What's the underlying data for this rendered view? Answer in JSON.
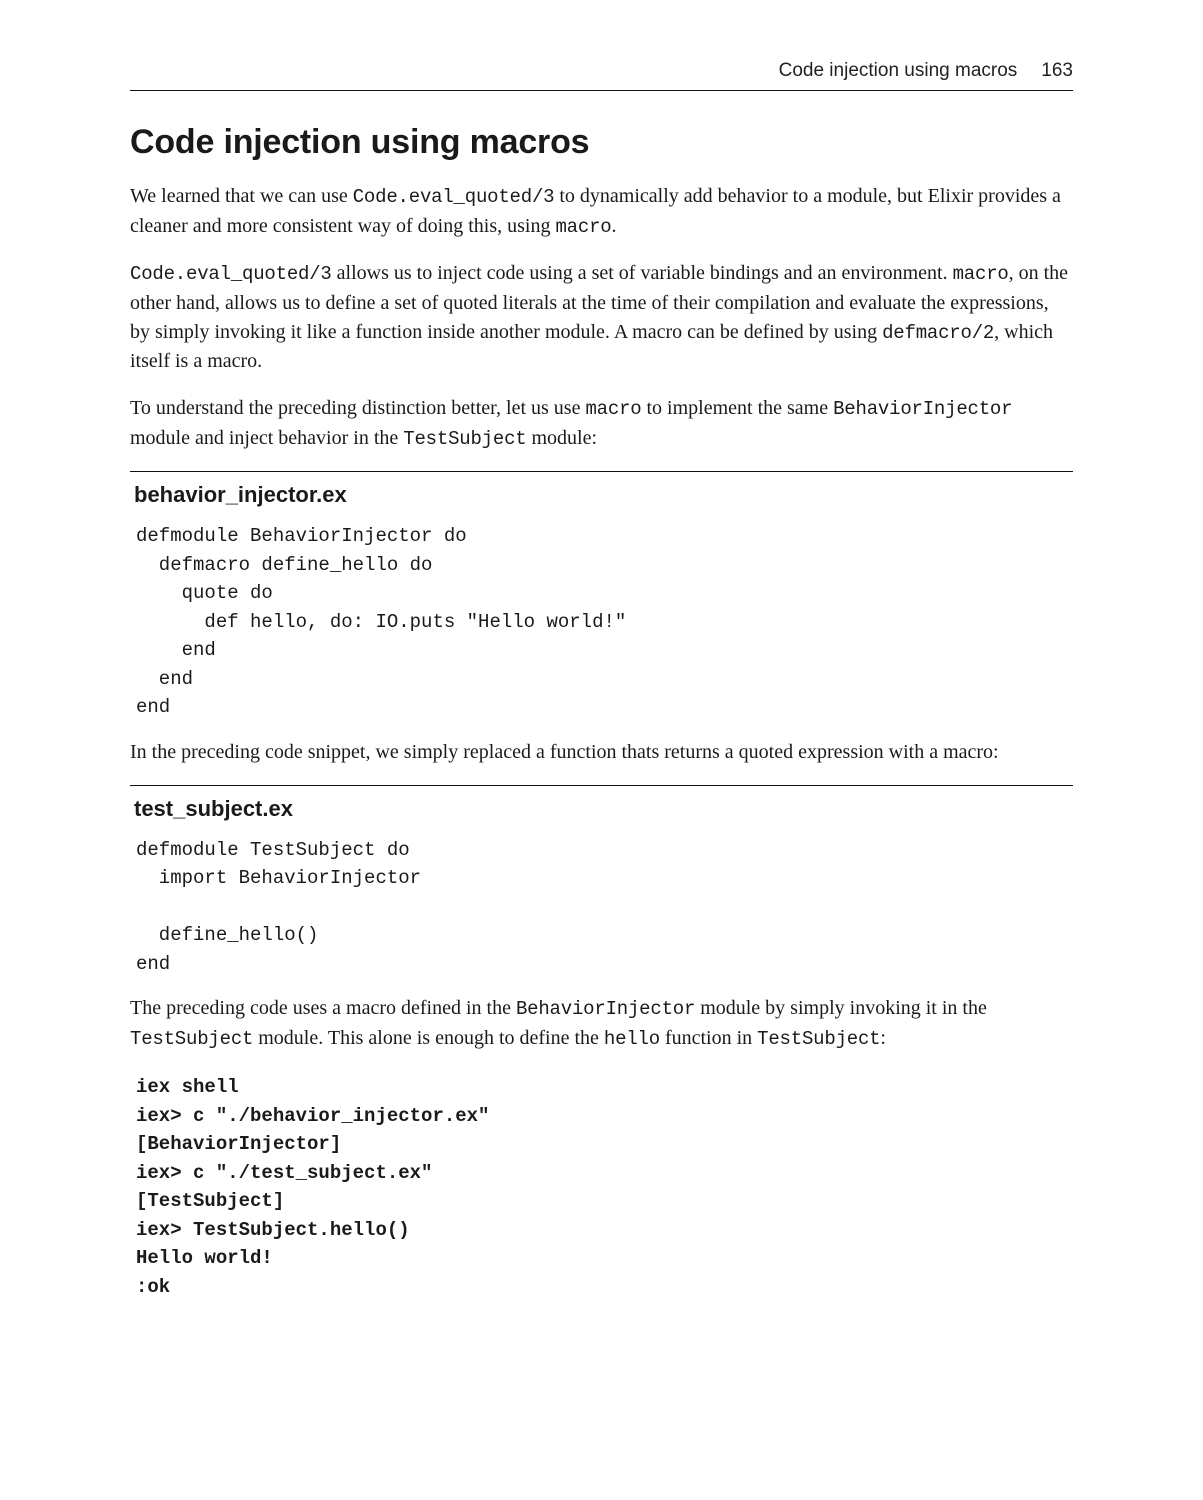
{
  "header": {
    "running_title": "Code injection using macros",
    "page_number": "163"
  },
  "section_title": "Code injection using macros",
  "p1_parts": [
    "We learned that we can use ",
    "Code.eval_quoted/3",
    " to dynamically add behavior to a module, but Elixir provides a cleaner and more consistent way of doing this, using ",
    "macro",
    "."
  ],
  "p2_parts": [
    "Code.eval_quoted/3",
    " allows us to inject code using a set of variable bindings and an environment. ",
    "macro",
    ", on the other hand, allows us to define a set of quoted literals at the time of their compilation and evaluate the expressions, by simply invoking it like a function inside another module. A macro can be defined by using ",
    "defmacro/2",
    ", which itself is a macro."
  ],
  "p3_parts": [
    "To understand the preceding distinction better, let us use ",
    "macro",
    " to implement the same ",
    "BehaviorInjector",
    " module and inject behavior in the ",
    "TestSubject",
    " module:"
  ],
  "code1": {
    "filename": "behavior_injector.ex",
    "content": "defmodule BehaviorInjector do\n  defmacro define_hello do\n    quote do\n      def hello, do: IO.puts \"Hello world!\"\n    end\n  end\nend"
  },
  "p4": "In the preceding code snippet, we simply replaced a function thats returns a quoted expression with a macro:",
  "code2": {
    "filename": "test_subject.ex",
    "content": "defmodule TestSubject do\n  import BehaviorInjector\n\n  define_hello()\nend"
  },
  "p5_parts": [
    "The preceding code uses a macro defined in the ",
    "BehaviorInjector",
    " module by simply invoking it in the ",
    "TestSubject",
    " module. This alone is enough to define the ",
    "hello",
    " function in ",
    "TestSubject",
    ":"
  ],
  "code3": {
    "content": "iex shell\niex> c \"./behavior_injector.ex\"\n[BehaviorInjector]\niex> c \"./test_subject.ex\"\n[TestSubject]\niex> TestSubject.hello()\nHello world!\n:ok"
  }
}
